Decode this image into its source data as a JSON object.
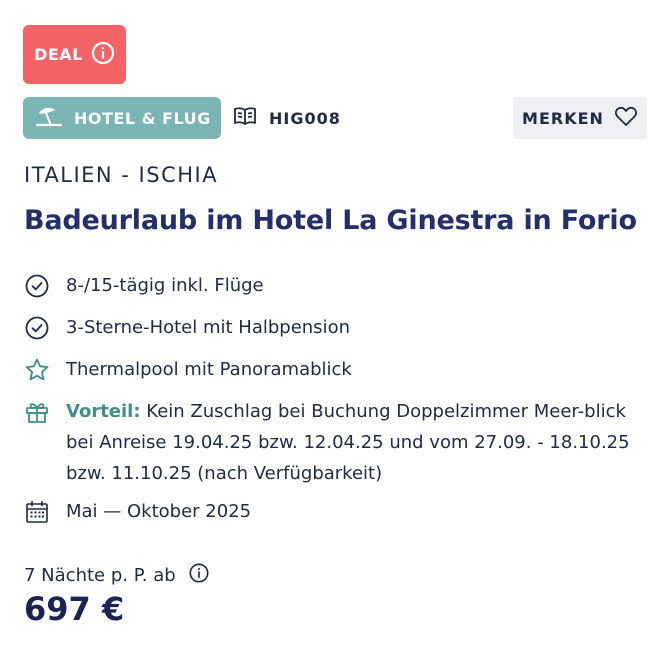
{
  "deal": {
    "label": "DEAL",
    "icon": "info-icon"
  },
  "badge": {
    "label": "HOTEL & FLUG",
    "icon": "beach-umbrella-icon"
  },
  "code": {
    "label": "HIG008",
    "icon": "book-icon"
  },
  "merken": {
    "label": "MERKEN",
    "icon": "heart-icon"
  },
  "location": "ITALIEN - ISCHIA",
  "title": "Badeurlaub im Hotel La Ginestra in Forio",
  "features": [
    {
      "icon": "check-circle-icon",
      "text": "8-/15-tägig inkl. Flüge"
    },
    {
      "icon": "check-circle-icon",
      "text": "3-Sterne-Hotel mit Halbpension"
    },
    {
      "icon": "star-icon",
      "text": "Thermalpool mit Panoramablick"
    },
    {
      "icon": "gift-icon",
      "label": "Vorteil:",
      "text": "Kein Zuschlag bei Buchung Doppelzimmer Meer-blick bei Anreise 19.04.25 bzw. 12.04.25 und vom 27.09. - 18.10.25 bzw. 11.10.25 (nach Verfügbarkeit)"
    },
    {
      "icon": "calendar-icon",
      "text": "Mai — Oktober 2025"
    }
  ],
  "price": {
    "label": "7 Nächte p. P. ab",
    "value": "697 €"
  },
  "colors": {
    "deal": "#f46467",
    "badge": "#7ab5b3",
    "accent_green": "#3f8f88",
    "title": "#232e6b",
    "merken_bg": "#eef0f4"
  }
}
